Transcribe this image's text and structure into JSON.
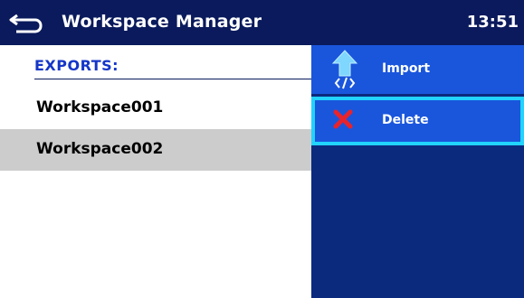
{
  "header": {
    "title": "Workspace Manager",
    "time": "13:51",
    "back_icon": "back-arrow-icon"
  },
  "list": {
    "section_label": "EXPORTS:",
    "items": [
      {
        "label": "Workspace001",
        "selected": false
      },
      {
        "label": "Workspace002",
        "selected": true
      }
    ]
  },
  "menu": {
    "items": [
      {
        "label": "Import",
        "icon": "import-icon",
        "focused": false
      },
      {
        "label": "Delete",
        "icon": "delete-x-icon",
        "focused": true
      }
    ]
  },
  "colors": {
    "titlebar": "#0a1a5c",
    "panel": "#0b2a7d",
    "menu_item": "#1a56dc",
    "focus_border": "#22d3ff",
    "section_label": "#1436c8",
    "selected_row": "#cccccc",
    "delete_icon": "#e8232a"
  }
}
